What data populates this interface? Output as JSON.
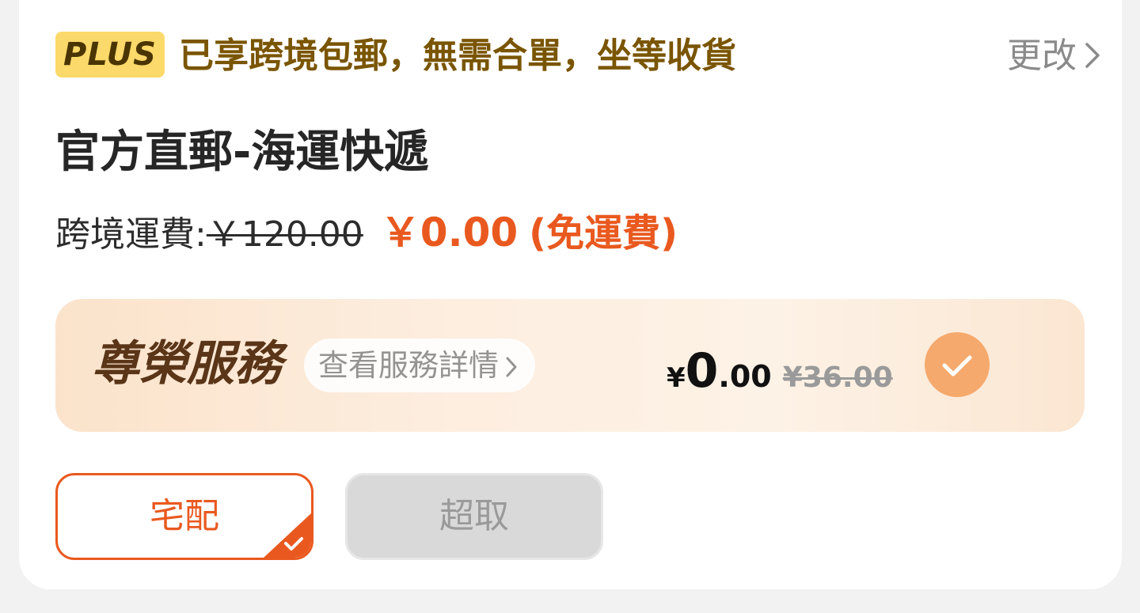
{
  "promo": {
    "badge": "PLUS",
    "text": "已享跨境包郵，無需合單，坐等收貨",
    "change_label": "更改"
  },
  "shipping": {
    "method_title": "官方直郵-海運快遞",
    "fee_label": "跨境運費:",
    "fee_original": "￥120.00",
    "fee_current": "￥0.00",
    "fee_note": "(免運費)"
  },
  "service": {
    "title": "尊榮服務",
    "detail_label": "查看服務詳情",
    "price_currency": "¥",
    "price_integer": "0",
    "price_decimal": ".00",
    "price_original": "¥36.00"
  },
  "delivery_options": {
    "home_label": "宅配",
    "pickup_label": "超取"
  },
  "colors": {
    "accent": "#e9591f",
    "plus_badge": "#fbd96a",
    "promo_text": "#7a5500",
    "service_check": "#f6a96d"
  }
}
